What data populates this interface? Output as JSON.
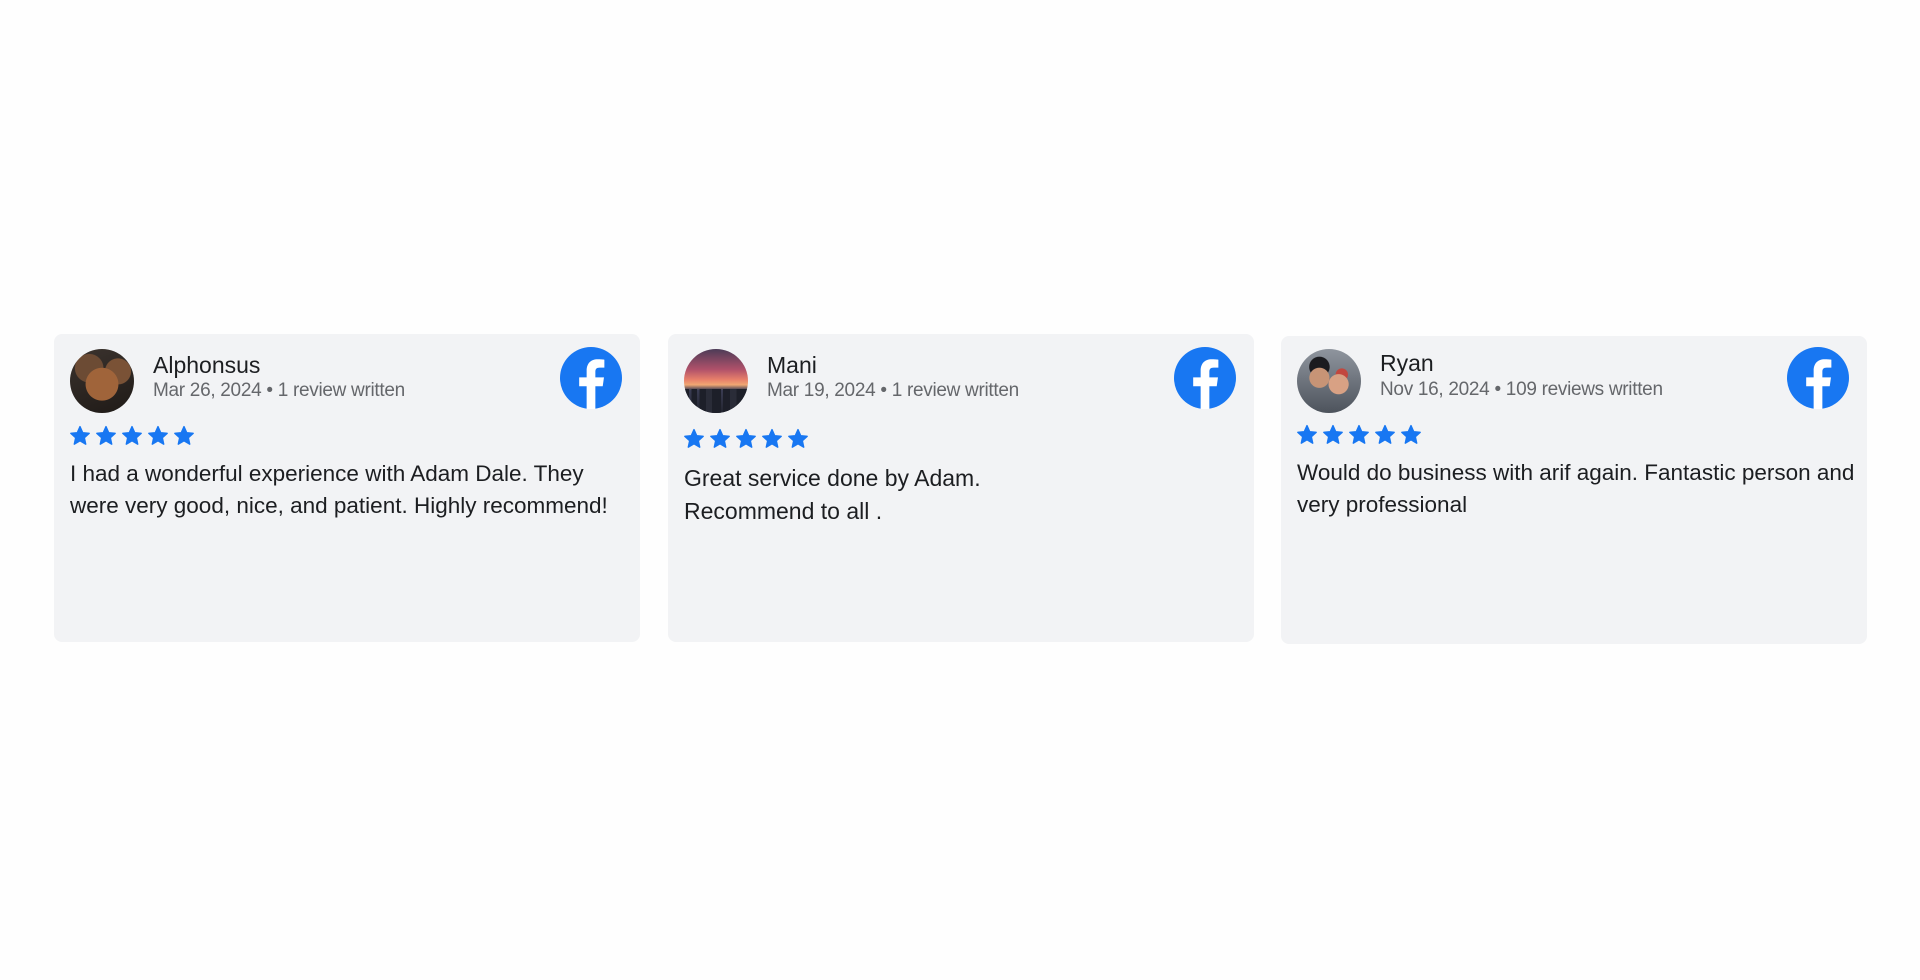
{
  "colors": {
    "card_background": "#f2f3f5",
    "star_color": "#1877f2",
    "facebook_blue": "#1877f2",
    "name_color": "#1c1e21",
    "meta_color": "#65676b"
  },
  "reviews": [
    {
      "name": "Alphonsus",
      "date": "Mar  26,  2024",
      "separator": "•",
      "review_count": "1 review written",
      "rating": 5,
      "text": "I had a wonderful experience with Adam Dale. They were very good, nice, and patient. Highly recommend!",
      "source_icon": "facebook-icon",
      "avatar": "reviewer-photo"
    },
    {
      "name": "Mani",
      "date": "Mar  19,  2024",
      "separator": "•",
      "review_count": "1 review written",
      "rating": 5,
      "text": "Great service done by Adam. Recommend to all .",
      "source_icon": "facebook-icon",
      "avatar": "reviewer-photo"
    },
    {
      "name": "Ryan",
      "date": "Nov  16,  2024",
      "separator": "•",
      "review_count": "109 reviews written",
      "rating": 5,
      "text": "Would do business with arif again. Fantastic person and very professional",
      "source_icon": "facebook-icon",
      "avatar": "reviewer-photo"
    }
  ]
}
